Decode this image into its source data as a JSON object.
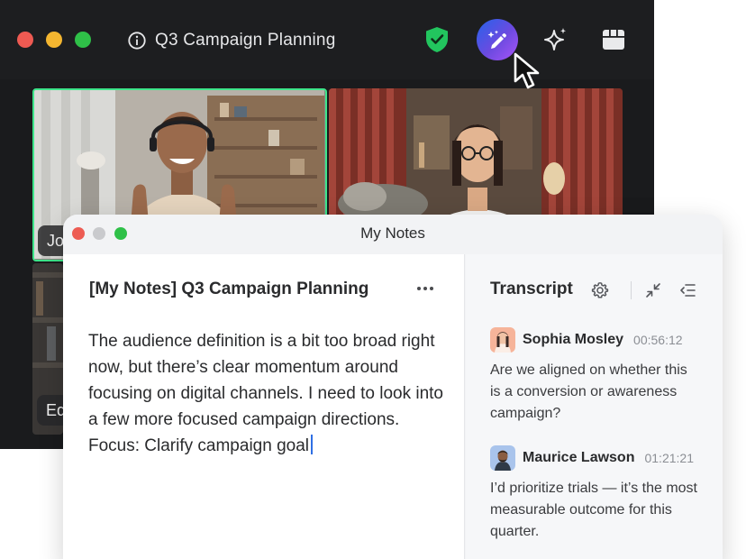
{
  "meeting": {
    "title": "Q3 Campaign Planning",
    "participants": [
      {
        "label": "Jo"
      },
      {
        "label": ""
      },
      {
        "label": "Ed"
      }
    ]
  },
  "notes_window": {
    "title": "My Notes",
    "document": {
      "title": "[My Notes] Q3 Campaign Planning",
      "body": "The audience definition is a bit too broad right now, but there’s clear momentum around focusing on digital channels. I need to look into a few more focused campaign directions.",
      "focus_line": "Focus: Clarify campaign goal"
    },
    "transcript": {
      "title": "Transcript",
      "entries": [
        {
          "speaker": "Sophia Mosley",
          "time": "00:56:12",
          "text": "Are we aligned on whether this is a conversion or awareness campaign?"
        },
        {
          "speaker": "Maurice Lawson",
          "time": "01:21:21",
          "text": "I’d prioritize trials — it’s the most measurable outcome for this quarter."
        }
      ]
    }
  },
  "colors": {
    "accent_green": "#3ee58a",
    "shield_green": "#22c55e",
    "ai_gradient_start": "#2563eb",
    "ai_gradient_end": "#a855f7",
    "caret_blue": "#2f6fe4"
  },
  "icons": [
    "info-icon",
    "notes-icon",
    "shield-check-icon",
    "ai-pen-icon",
    "sparkle-icon",
    "apps-icon",
    "cursor-icon",
    "more-icon",
    "gear-icon",
    "collapse-icon",
    "list-collapse-icon"
  ]
}
